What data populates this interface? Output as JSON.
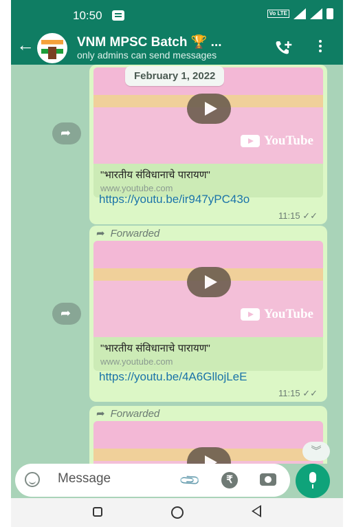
{
  "status_bar": {
    "time": "10:50",
    "volte_label": "Vo LTE"
  },
  "header": {
    "title": "VNM MPSC Batch 🏆 ...",
    "subtitle": "only admins can send messages"
  },
  "chat": {
    "date_chip": "February 1, 2022",
    "messages": [
      {
        "forwarded_label": "",
        "preview_title": "\"भारतीय संविधानाचे पारायण\"",
        "preview_site": "www.youtube.com",
        "link": "https://youtu.be/ir947yPC43o",
        "time": "11:15 ✓✓",
        "logo_text": "YouTube"
      },
      {
        "forwarded_label": "Forwarded",
        "preview_title": "\"भारतीय संविधानाचे पारायण\"",
        "preview_site": "www.youtube.com",
        "link": "https://youtu.be/4A6GllojLeE",
        "time": "11:15 ✓✓",
        "logo_text": "YouTube"
      },
      {
        "forwarded_label": "Forwarded"
      }
    ]
  },
  "composer": {
    "placeholder": "Message",
    "rupee_symbol": "₹"
  },
  "icons": [
    "back-arrow-icon",
    "group-avatar-icon",
    "add-call-icon",
    "more-options-icon",
    "share-icon",
    "play-icon",
    "youtube-logo-icon",
    "emoji-icon",
    "attach-icon",
    "rupee-icon",
    "camera-icon",
    "mic-icon",
    "scroll-down-icon"
  ],
  "colors": {
    "header": "#0f7d63",
    "bubble": "#dcf7c6",
    "link": "#1a73a8",
    "mic_button": "#0fa37a"
  }
}
